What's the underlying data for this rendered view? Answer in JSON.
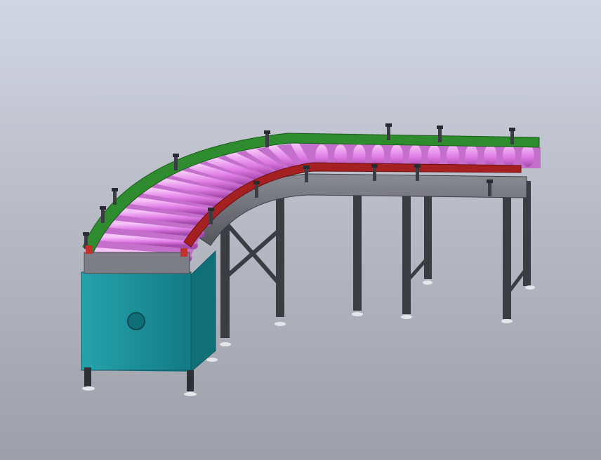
{
  "scene": {
    "subject": "curved-roller-conveyor-cad-model",
    "colors": {
      "background_top": "#d2d6e3",
      "background_bottom": "#9c9fa8",
      "outer_guard_rail": "#2e8b2e",
      "inner_guard_rail": "#a52020",
      "rollers": "#e07ce6",
      "roller_highlight": "#f6c4f8",
      "frame": "#6e6e74",
      "legs": "#3b3d42",
      "drive_box": "#1c9aa4",
      "feet": "#e6e6ea"
    },
    "roller_count": 26,
    "leg_count": 7
  }
}
